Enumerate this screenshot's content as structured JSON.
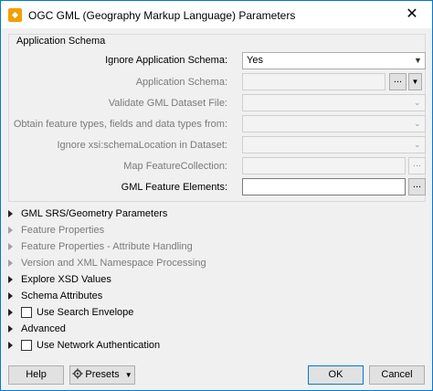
{
  "window": {
    "title": "OGC GML (Geography Markup Language) Parameters",
    "close_glyph": "✕"
  },
  "schema_section": {
    "title": "Application Schema",
    "rows": [
      {
        "label": "Ignore Application Schema:",
        "value": "Yes",
        "enabled": true
      },
      {
        "label": "Application Schema:",
        "value": "",
        "enabled": false
      },
      {
        "label": "Validate GML Dataset File:",
        "value": "",
        "enabled": false
      },
      {
        "label": "Obtain feature types, fields and data types from:",
        "value": "",
        "enabled": false
      },
      {
        "label": "Ignore xsi:schemaLocation in Dataset:",
        "value": "",
        "enabled": false
      },
      {
        "label": "Map FeatureCollection:",
        "value": "",
        "enabled": false
      },
      {
        "label": "GML Feature Elements:",
        "value": "",
        "enabled": true
      }
    ],
    "ellipsis": "..."
  },
  "groups": [
    {
      "label": "GML SRS/Geometry Parameters",
      "enabled": true,
      "checkbox": false
    },
    {
      "label": "Feature Properties",
      "enabled": false,
      "checkbox": false
    },
    {
      "label": "Feature Properties - Attribute Handling",
      "enabled": false,
      "checkbox": false
    },
    {
      "label": "Version and XML Namespace Processing",
      "enabled": false,
      "checkbox": false
    },
    {
      "label": "Explore XSD Values",
      "enabled": true,
      "checkbox": false
    },
    {
      "label": "Schema Attributes",
      "enabled": true,
      "checkbox": false
    },
    {
      "label": "Use Search Envelope",
      "enabled": true,
      "checkbox": true,
      "checked": false
    },
    {
      "label": "Advanced",
      "enabled": true,
      "checkbox": false
    },
    {
      "label": "Use Network Authentication",
      "enabled": true,
      "checkbox": true,
      "checked": false
    }
  ],
  "buttons": {
    "help": "Help",
    "presets": "Presets",
    "ok": "OK",
    "cancel": "Cancel"
  },
  "colors": {
    "accent": "#0078d7",
    "icon_orange": "#f0a000"
  }
}
